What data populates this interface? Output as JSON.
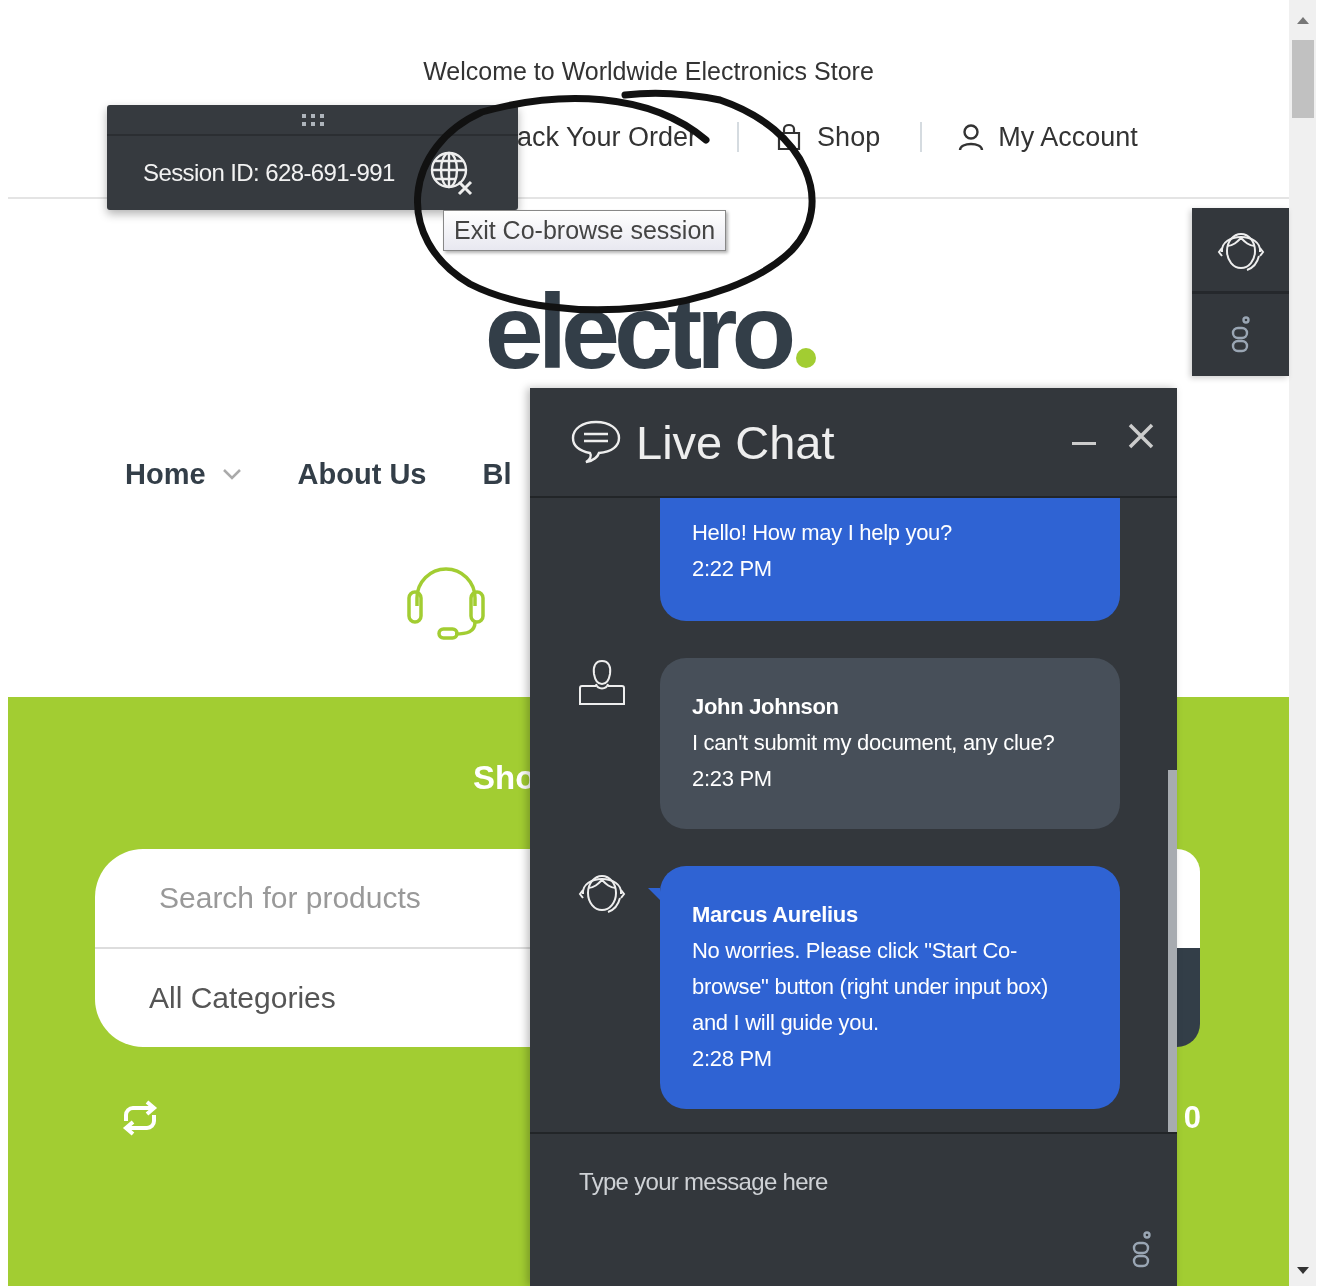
{
  "top_bar": {
    "welcome": "Welcome to Worldwide Electronics Store",
    "links": [
      {
        "label": "ack Your Order"
      },
      {
        "label": "Shop"
      },
      {
        "label": "My Account"
      }
    ]
  },
  "logo": {
    "text": "electro"
  },
  "nav": [
    {
      "label": "Home",
      "has_dropdown": true
    },
    {
      "label": "About Us",
      "has_dropdown": false
    },
    {
      "label": "Bl",
      "has_dropdown": false
    }
  ],
  "promo": {
    "heading": "Sho",
    "search_placeholder": "Search for products",
    "category": "All Categories",
    "amount": "0"
  },
  "cobrowse": {
    "session_label": "Session ID: 628-691-991",
    "tooltip": "Exit Co-browse session"
  },
  "chat": {
    "title": "Live Chat",
    "input_placeholder": "Type your message here",
    "messages": [
      {
        "kind": "agent",
        "text": "Hello! How may I help you?",
        "time": "2:22 PM"
      },
      {
        "kind": "customer",
        "name": "John Johnson",
        "text": "I can't submit my document, any clue?",
        "time": "2:23 PM"
      },
      {
        "kind": "agent",
        "name": "Marcus Aurelius",
        "text": "No worries. Please click \"Start Co-browse\" button (right under input box) and I will guide you.",
        "time": "2:28 PM"
      }
    ]
  }
}
